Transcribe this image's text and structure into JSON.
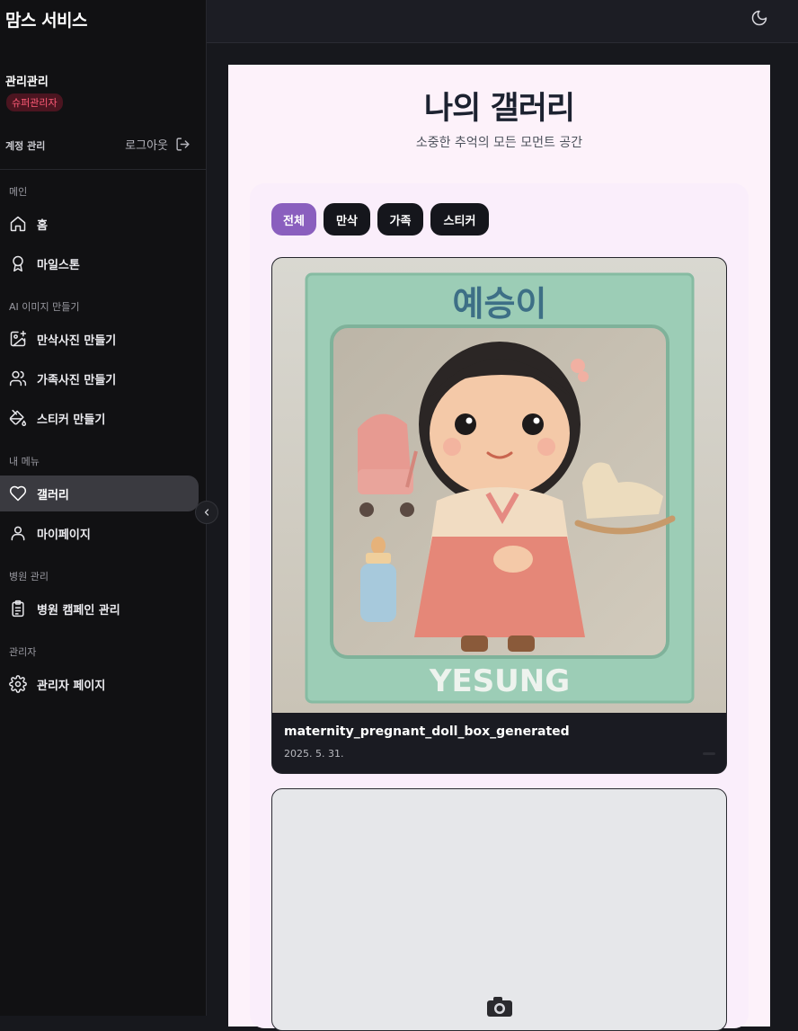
{
  "brand": "맘스 서비스",
  "user": {
    "name": "관리관리",
    "role": "슈퍼관리자"
  },
  "account": {
    "label": "계정 관리",
    "logout": "로그아웃"
  },
  "nav": {
    "section_main": "메인",
    "home": "홈",
    "milestone": "마일스톤",
    "section_ai": "AI 이미지 만들기",
    "maternity": "만삭사진 만들기",
    "family": "가족사진 만들기",
    "sticker": "스티커 만들기",
    "section_my": "내 메뉴",
    "gallery": "갤러리",
    "mypage": "마이페이지",
    "section_hospital": "병원 관리",
    "campaign": "병원 캠페인 관리",
    "section_admin": "관리자",
    "admin_page": "관리자 페이지"
  },
  "gallery": {
    "title": "나의 갤러리",
    "subtitle": "소중한 추억의 모든 모먼트 공간",
    "filters": [
      "전체",
      "만삭",
      "가족",
      "스티커"
    ],
    "active_filter": "전체",
    "items": [
      {
        "title": "maternity_pregnant_doll_box_generated",
        "date": "2025. 5. 31.",
        "box_label_top": "예승이",
        "box_label_bottom": "YESUNG"
      }
    ]
  },
  "colors": {
    "accent": "#8a5fbe",
    "sidebar_bg": "#111113",
    "page_bg": "#fdf2fa",
    "role_badge": "#ff5b77"
  }
}
